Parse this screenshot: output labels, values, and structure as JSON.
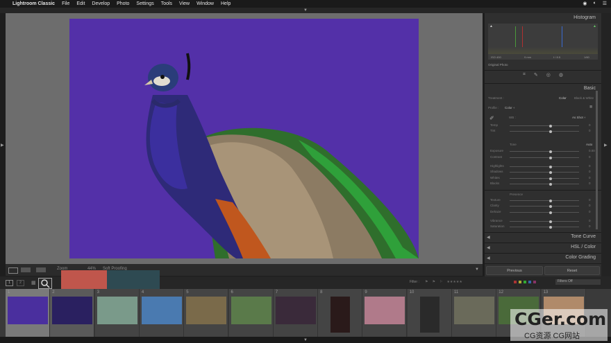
{
  "menubar": {
    "app_name": "Lightroom Classic",
    "items": [
      "File",
      "Edit",
      "Develop",
      "Photo",
      "Settings",
      "Tools",
      "View",
      "Window",
      "Help"
    ],
    "right_icons": [
      "eye-icon",
      "circle-icon",
      "list-icon"
    ]
  },
  "panel": {
    "histogram_title": "Histogram",
    "histogram_readouts": [
      "ISO 400",
      "9 mm",
      "f / 8.5",
      "1/60"
    ],
    "original_photo": "Original Photo",
    "basic_title": "Basic",
    "treatment_label": "Treatment :",
    "color_label": "Color",
    "bw_label": "Black & White",
    "profile_label": "Profile :",
    "profile_value": "Color ÷",
    "wb_label": "WB :",
    "wb_value": "As Shot ÷",
    "temp_label": "Temp",
    "tint_label": "Tint",
    "tone_label": "Tone",
    "auto_label": "Auto",
    "exposure_label": "Exposure",
    "exposure_value": "0.00",
    "contrast_label": "Contrast",
    "highlights_label": "Highlights",
    "shadows_label": "Shadows",
    "whites_label": "Whites",
    "blacks_label": "Blacks",
    "presence_label": "Presence",
    "texture_label": "Texture",
    "clarity_label": "Clarity",
    "dehaze_label": "Dehaze",
    "vibrance_label": "Vibrance",
    "saturation_label": "Saturation",
    "zero": "0",
    "tone_curve_title": "Tone Curve",
    "hsl_title": "HSL / Color",
    "color_grading_title": "Color Grading",
    "previous_label": "Previous",
    "reset_label": "Reset"
  },
  "toolbar": {
    "zoom_label": "Zoom",
    "zoom_value": "44%",
    "soft_proofing": "Soft Proofing"
  },
  "filmbar": {
    "filter_label": "Filter :",
    "filters_off": "Filters Off",
    "page_1": "1",
    "page_2": "2"
  },
  "filmstrip": {
    "numbers": [
      "1",
      "2",
      "3",
      "4",
      "5",
      "6",
      "7",
      "8",
      "9",
      "10",
      "11",
      "12",
      "13"
    ]
  },
  "watermark": {
    "main": "CGer.com",
    "sub": "CG资源 CG网站"
  },
  "colors": {
    "photo_background": "#5330a8",
    "swatch_left": "#c0564c",
    "swatch_right": "#2e4a52"
  }
}
